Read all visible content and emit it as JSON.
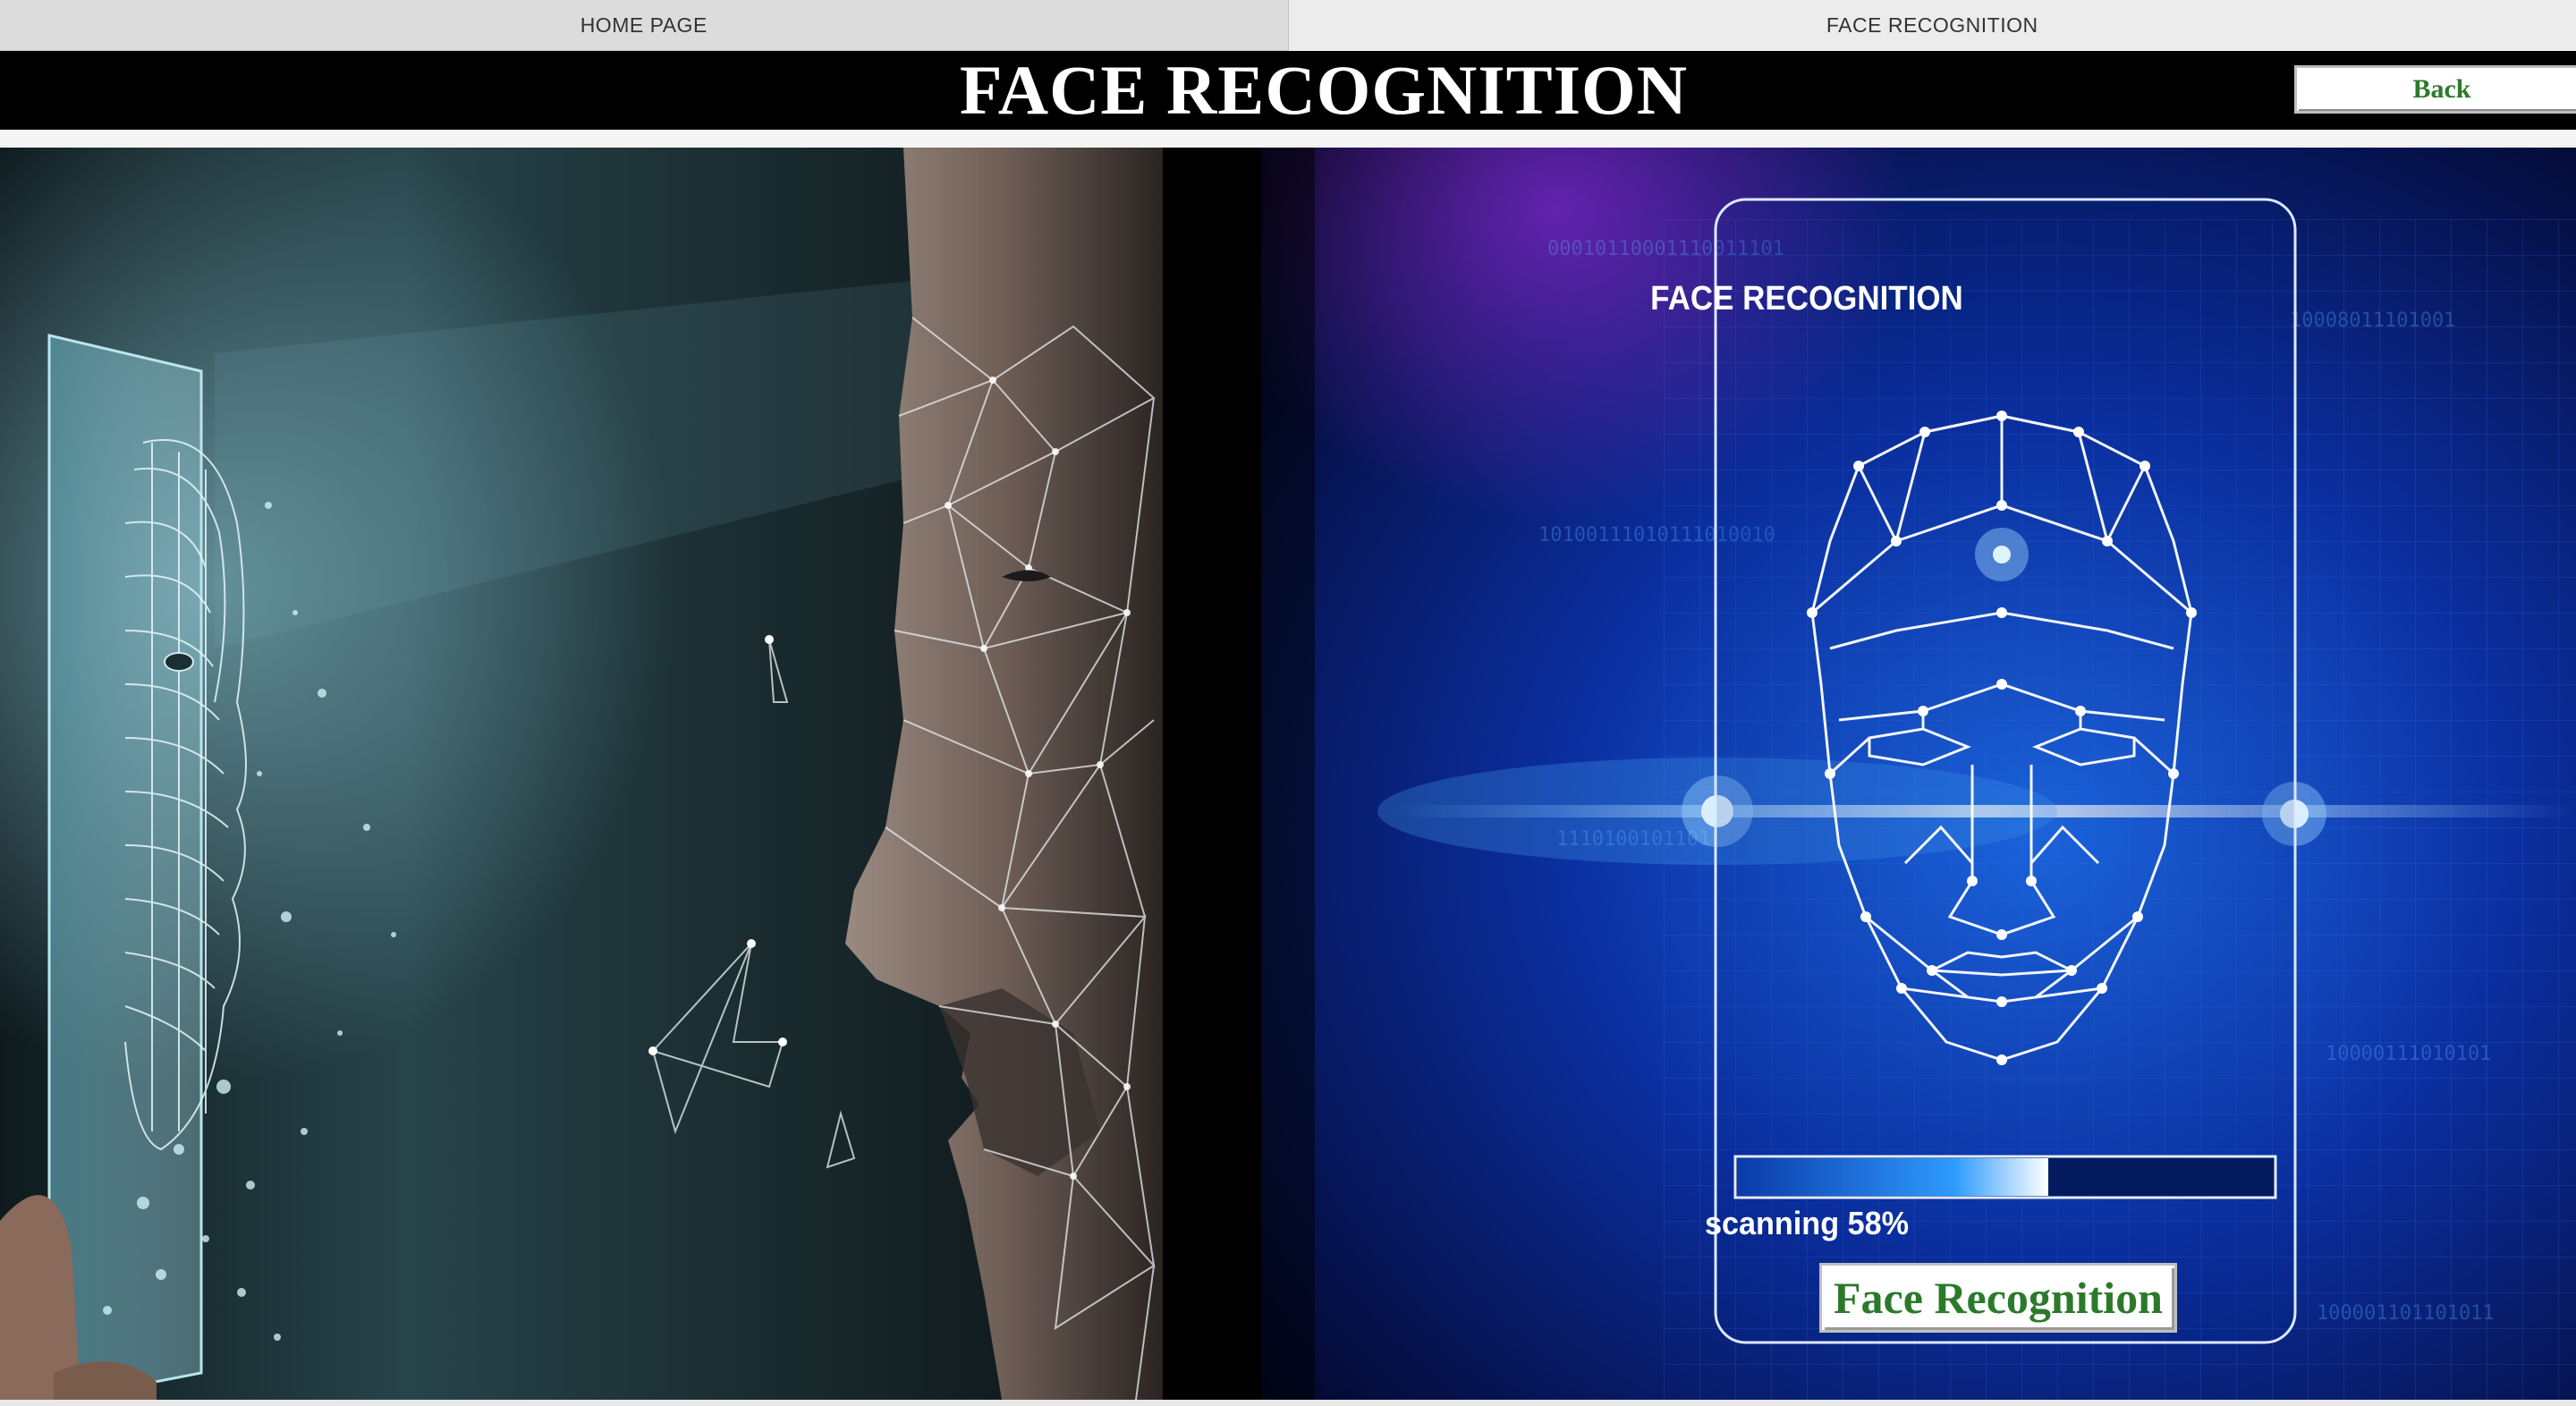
{
  "tabs": [
    {
      "label": "HOME PAGE",
      "active": false
    },
    {
      "label": "FACE RECOGNITION",
      "active": true
    }
  ],
  "header": {
    "title": "FACE RECOGNITION",
    "back_label": "Back"
  },
  "scanner": {
    "title": "FACE RECOGNITION",
    "status": "scanning 58%",
    "progress": 0.58,
    "button_label": "Face Recognition"
  },
  "colors": {
    "header_bg": "#000000",
    "button_text": "#2c7a2c",
    "scan_blue": "#1e6cff"
  },
  "images": {
    "left": "man-profile-facing-phone-with-wireframe-face",
    "right": "blue-face-scanning-wireframe"
  }
}
